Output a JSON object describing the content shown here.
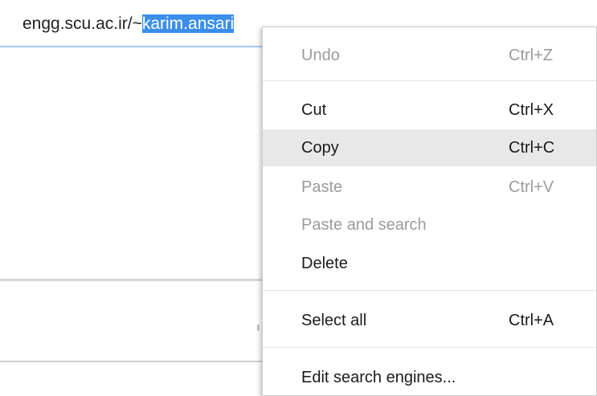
{
  "address_bar": {
    "url_prefix": "engg.scu.ac.ir/~",
    "url_selected": "karim.ansari"
  },
  "context_menu": {
    "items": [
      {
        "label": "Undo",
        "shortcut": "Ctrl+Z",
        "enabled": false
      },
      {
        "label": "Cut",
        "shortcut": "Ctrl+X",
        "enabled": true
      },
      {
        "label": "Copy",
        "shortcut": "Ctrl+C",
        "enabled": true,
        "highlighted": true
      },
      {
        "label": "Paste",
        "shortcut": "Ctrl+V",
        "enabled": false
      },
      {
        "label": "Paste and search",
        "shortcut": "",
        "enabled": false
      },
      {
        "label": "Delete",
        "shortcut": "",
        "enabled": true
      },
      {
        "label": "Select all",
        "shortcut": "Ctrl+A",
        "enabled": true
      },
      {
        "label": "Edit search engines...",
        "shortcut": "",
        "enabled": true
      }
    ]
  },
  "colors": {
    "selection": "#3b8eea",
    "menu_hover": "#e8e8e8",
    "disabled_text": "#9b9b9b"
  }
}
